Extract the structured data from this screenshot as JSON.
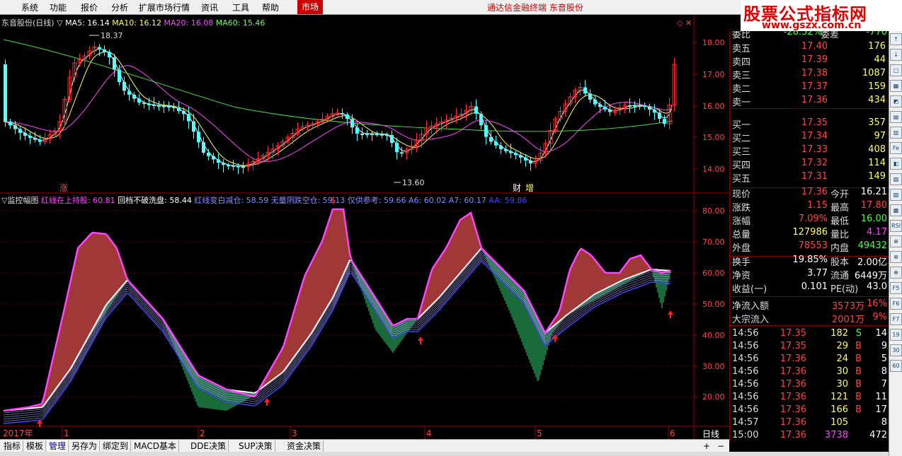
{
  "menu": {
    "items": [
      "系统",
      "功能",
      "报价",
      "分析",
      "扩展市场行情",
      "资讯",
      "工具",
      "帮助"
    ],
    "active": "市场",
    "center_title": "通达信金融终端  东音股份"
  },
  "watermark": {
    "title": "股票公式指标网",
    "url": "www.gszx.com.cn"
  },
  "main_chart": {
    "title": "东音股份(日线)",
    "ma_legend": [
      {
        "label": "MA5: 16.14",
        "color": "#ffffff"
      },
      {
        "label": "MA10: 16.12",
        "color": "#ffff66"
      },
      {
        "label": "MA20: 16.08",
        "color": "#ff44ff"
      },
      {
        "label": "MA60: 15.46",
        "color": "#66ff66"
      }
    ],
    "y_ticks": [
      "18.00",
      "17.00",
      "16.00",
      "15.00",
      "14.00"
    ],
    "high_label": "18.37",
    "low_label": "13.60",
    "markers": [
      "涨",
      "$",
      "财",
      "增"
    ]
  },
  "indicator": {
    "legend": [
      {
        "label": "▽监控幅图",
        "color": "#dddddd"
      },
      {
        "label": "红线在上持股: 60.81",
        "color": "#ff44ff"
      },
      {
        "label": "回档不破洗盘: 58.44",
        "color": "#ffffff"
      },
      {
        "label": "红线变白减仓: 58.59",
        "color": "#8888ff"
      },
      {
        "label": "无量阴跌空仓: 59.13",
        "color": "#8888ff"
      },
      {
        "label": "仅供参考: 59.66",
        "color": "#8888ff"
      },
      {
        "label": "A6: 60.02",
        "color": "#8888ff"
      },
      {
        "label": "A7: 60.17",
        "color": "#8888ff"
      },
      {
        "label": "AA: 59.86",
        "color": "#4444ff"
      }
    ],
    "y_ticks": [
      "80.00",
      "70.00",
      "60.00",
      "50.00",
      "40.00",
      "30.00",
      "20.00"
    ]
  },
  "x_axis": {
    "labels": [
      "2017年",
      "1",
      "2",
      "3",
      "4",
      "5",
      "6"
    ],
    "period": "日线"
  },
  "quote": {
    "header": {
      "label": "委比",
      "value": "-28.52%",
      "label2": "委差",
      "value2": "-770"
    },
    "asks": [
      {
        "label": "卖五",
        "price": "17.40",
        "vol": "176"
      },
      {
        "label": "卖四",
        "price": "17.39",
        "vol": "44"
      },
      {
        "label": "卖三",
        "price": "17.38",
        "vol": "1087"
      },
      {
        "label": "卖二",
        "price": "17.37",
        "vol": "159"
      },
      {
        "label": "卖一",
        "price": "17.36",
        "vol": "434"
      }
    ],
    "bids": [
      {
        "label": "买一",
        "price": "17.35",
        "vol": "357"
      },
      {
        "label": "买二",
        "price": "17.34",
        "vol": "97"
      },
      {
        "label": "买三",
        "price": "17.33",
        "vol": "408"
      },
      {
        "label": "买四",
        "price": "17.32",
        "vol": "114"
      },
      {
        "label": "买五",
        "price": "17.31",
        "vol": "149"
      }
    ],
    "stats": [
      {
        "l1": "现价",
        "v1": "17.36",
        "c1": "#ff4444",
        "l2": "今开",
        "v2": "16.21",
        "c2": "#ffffff"
      },
      {
        "l1": "涨跌",
        "v1": "1.15",
        "c1": "#ff4444",
        "l2": "最高",
        "v2": "17.80",
        "c2": "#ff4444"
      },
      {
        "l1": "涨幅",
        "v1": "7.09%",
        "c1": "#ff4444",
        "l2": "最低",
        "v2": "16.00",
        "c2": "#44ff44"
      },
      {
        "l1": "总量",
        "v1": "127986",
        "c1": "#ffff66",
        "l2": "量比",
        "v2": "4.17",
        "c2": "#ff44ff"
      },
      {
        "l1": "外盘",
        "v1": "78553",
        "c1": "#ff4444",
        "l2": "内盘",
        "v2": "49432",
        "c2": "#44ff44"
      }
    ],
    "stats2": [
      {
        "l1": "换手",
        "v1": "19.85%",
        "l2": "股本",
        "v2": "2.00亿"
      },
      {
        "l1": "净资",
        "v1": "3.77",
        "l2": "流通",
        "v2": "6449万"
      },
      {
        "l1": "收益(一)",
        "v1": "0.101",
        "l2": "PE(动)",
        "v2": "43.0"
      }
    ],
    "flow": [
      {
        "label": "净流入额",
        "value": "3573万",
        "pct": "16%"
      },
      {
        "label": "大宗流入",
        "value": "2001万",
        "pct": "9%"
      }
    ],
    "ticks": [
      {
        "t": "14:56",
        "p": "17.35",
        "v": "182",
        "s": "S",
        "n": "14"
      },
      {
        "t": "14:56",
        "p": "17.35",
        "v": "29",
        "s": "B",
        "n": "9"
      },
      {
        "t": "14:56",
        "p": "17.36",
        "v": "24",
        "s": "B",
        "n": "5"
      },
      {
        "t": "14:56",
        "p": "17.36",
        "v": "30",
        "s": "B",
        "n": "8"
      },
      {
        "t": "14:56",
        "p": "17.36",
        "v": "30",
        "s": "B",
        "n": "7"
      },
      {
        "t": "14:56",
        "p": "17.36",
        "v": "121",
        "s": "B",
        "n": "11"
      },
      {
        "t": "14:56",
        "p": "17.36",
        "v": "166",
        "s": "B",
        "n": "17"
      },
      {
        "t": "14:57",
        "p": "17.36",
        "v": "105",
        "s": "",
        "n": "8"
      },
      {
        "t": "15:00",
        "p": "17.36",
        "v": "3738",
        "s": "",
        "n": "472"
      }
    ]
  },
  "bottom_tabs": [
    "指标",
    "模板",
    "管理",
    "另存为",
    "绑定到",
    "MACD基本",
    "DDE决策",
    "SUP决策",
    "资金决策"
  ],
  "bottom_selected": "管理",
  "bottom_controls": [
    "+",
    "−"
  ],
  "side_tools": [
    "↑",
    "↓",
    "□",
    "▦",
    "◩",
    "▤",
    "▥",
    "Fe",
    "◧",
    "▧",
    "▨",
    "▩",
    "RSI",
    "⊕",
    "⊕",
    "⊕",
    "F5",
    "F6",
    "F7",
    "19",
    "30",
    "60"
  ]
}
